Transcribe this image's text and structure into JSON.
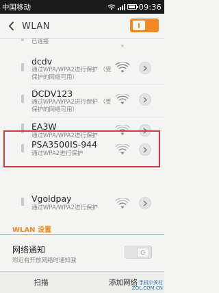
{
  "status_bar": {
    "carrier": "中国移动",
    "time": "09:36"
  },
  "header": {
    "title": "WLAN",
    "wlan_enabled": true
  },
  "networks": [
    {
      "name": "",
      "status": "已连接",
      "signal_level": 3
    },
    {
      "name": "dcdv",
      "status": "通过WPA/WPA2进行保护 （受保护的网络可用）",
      "signal_level": 3
    },
    {
      "name": "DCDV123",
      "status": "通过WPA/WPA2进行保护 （受保护的网络可用）",
      "signal_level": 3
    },
    {
      "name": "EA3W",
      "status": "通过WPA/WPA2进行保护",
      "signal_level": 2
    },
    {
      "name": "PSA3500IS-944",
      "status": "通过WPA2进行保护",
      "signal_level": 2
    },
    {
      "name": "Vgoldpay",
      "status": "通过WPA/WPA2进行保护",
      "signal_level": 2
    }
  ],
  "settings": {
    "section_title": "WLAN 设置",
    "notify_title": "网络通知",
    "notify_desc": "附近有开放网络时通知我",
    "notify_enabled": false
  },
  "bottom_bar": {
    "scan_label": "扫描",
    "add_label": "添加网络"
  },
  "watermark": {
    "line1": "手机中关村",
    "line2": "ZOL.COM.CN"
  },
  "colors": {
    "accent": "#f28a21",
    "highlight": "#d43c3c"
  }
}
